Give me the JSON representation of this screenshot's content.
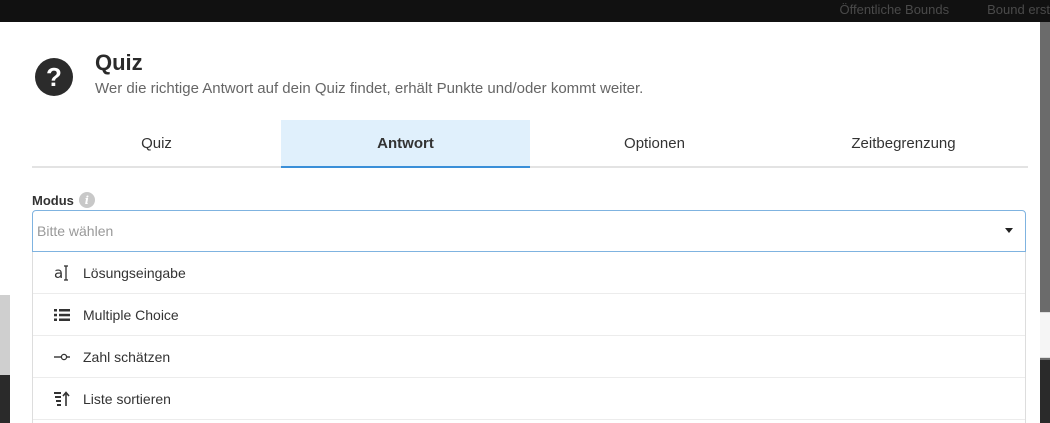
{
  "topbar": {
    "links": [
      "Öffentliche Bounds",
      "Bound erst"
    ]
  },
  "modal": {
    "title": "Quiz",
    "subtitle": "Wer die richtige Antwort auf dein Quiz findet, erhält Punkte und/oder kommt weiter.",
    "tabs": [
      {
        "label": "Quiz",
        "active": false
      },
      {
        "label": "Antwort",
        "active": true
      },
      {
        "label": "Optionen",
        "active": false
      },
      {
        "label": "Zeitbegrenzung",
        "active": false
      }
    ],
    "mode": {
      "label": "Modus",
      "placeholder": "Bitte wählen",
      "options": [
        {
          "label": "Lösungseingabe",
          "icon": "text-cursor-icon"
        },
        {
          "label": "Multiple Choice",
          "icon": "list-icon"
        },
        {
          "label": "Zahl schätzen",
          "icon": "slider-icon"
        },
        {
          "label": "Liste sortieren",
          "icon": "sort-icon"
        }
      ]
    }
  },
  "colors": {
    "active_tab_bg": "#e0f0fc",
    "active_tab_border": "#3a8fd8",
    "select_border": "#7fb3e0"
  }
}
